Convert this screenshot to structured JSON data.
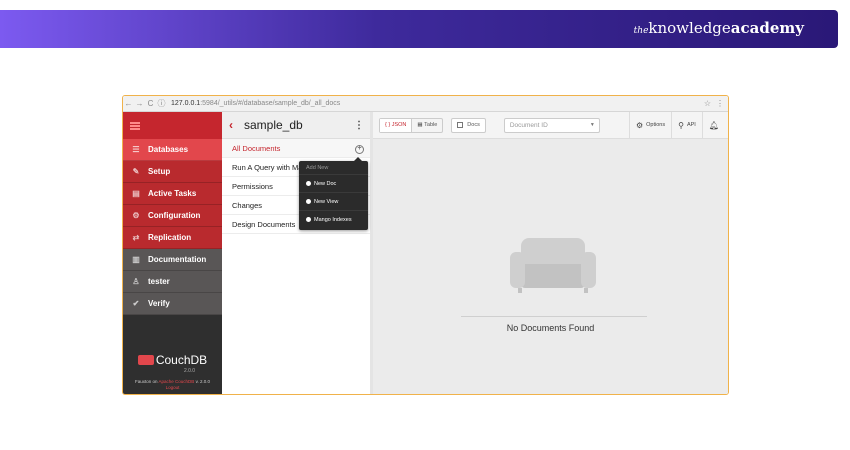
{
  "banner": {
    "brand_the": "the",
    "brand_knowledge": "knowledge",
    "brand_academy": "academy"
  },
  "browser": {
    "url_host": "127.0.0.1",
    "url_rest": ":5984/_utils/#/database/sample_db/_all_docs"
  },
  "sidebar": {
    "items": [
      {
        "label": "Databases",
        "icon": "database-icon"
      },
      {
        "label": "Setup",
        "icon": "wrench-icon"
      },
      {
        "label": "Active Tasks",
        "icon": "tasks-icon"
      },
      {
        "label": "Configuration",
        "icon": "gear-icon"
      },
      {
        "label": "Replication",
        "icon": "replication-icon"
      },
      {
        "label": "Documentation",
        "icon": "book-icon"
      },
      {
        "label": "tester",
        "icon": "user-icon"
      },
      {
        "label": "Verify",
        "icon": "check-icon"
      }
    ],
    "logo_text": "CouchDB",
    "logo_version": "2.0.0",
    "footer_prefix": "Fauxton on",
    "footer_link": "Apache CouchDB",
    "footer_suffix": "v. 2.0.0",
    "logout": "Logout"
  },
  "database": {
    "name": "sample_db",
    "nav": [
      "All Documents",
      "Run A Query with Mango",
      "Permissions",
      "Changes",
      "Design Documents"
    ]
  },
  "add_new_menu": {
    "header": "Add New",
    "items": [
      "New Doc",
      "New View",
      "Mango Indexes"
    ]
  },
  "toolbar": {
    "json_label": "{ } JSON",
    "table_label": "Table",
    "docs_label": "Docs",
    "docid_placeholder": "Document ID",
    "options_label": "Options",
    "api_label": "API"
  },
  "main": {
    "empty_message": "No Documents Found"
  },
  "colors": {
    "couch_red": "#c5262e",
    "active_red": "#e2474c",
    "banner_start": "#7c5af0",
    "banner_end": "#2a1877"
  }
}
